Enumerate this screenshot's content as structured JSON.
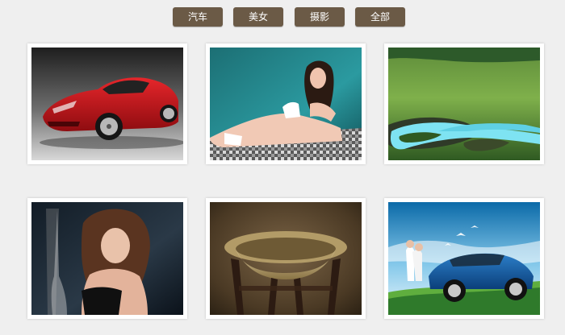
{
  "filters": [
    {
      "label": "汽车"
    },
    {
      "label": "美女"
    },
    {
      "label": "摄影"
    },
    {
      "label": "全部"
    }
  ],
  "colors": {
    "button_bg": "#6b5a46",
    "button_text": "#ffffff",
    "page_bg": "#efefef"
  },
  "gallery": {
    "items": [
      {
        "kind": "red-sports-car-photo"
      },
      {
        "kind": "woman-by-pool-photo"
      },
      {
        "kind": "grassland-river-photo"
      },
      {
        "kind": "woman-portrait-photo"
      },
      {
        "kind": "brass-bowl-stand-photo"
      },
      {
        "kind": "blue-car-and-couple-photo"
      }
    ]
  }
}
